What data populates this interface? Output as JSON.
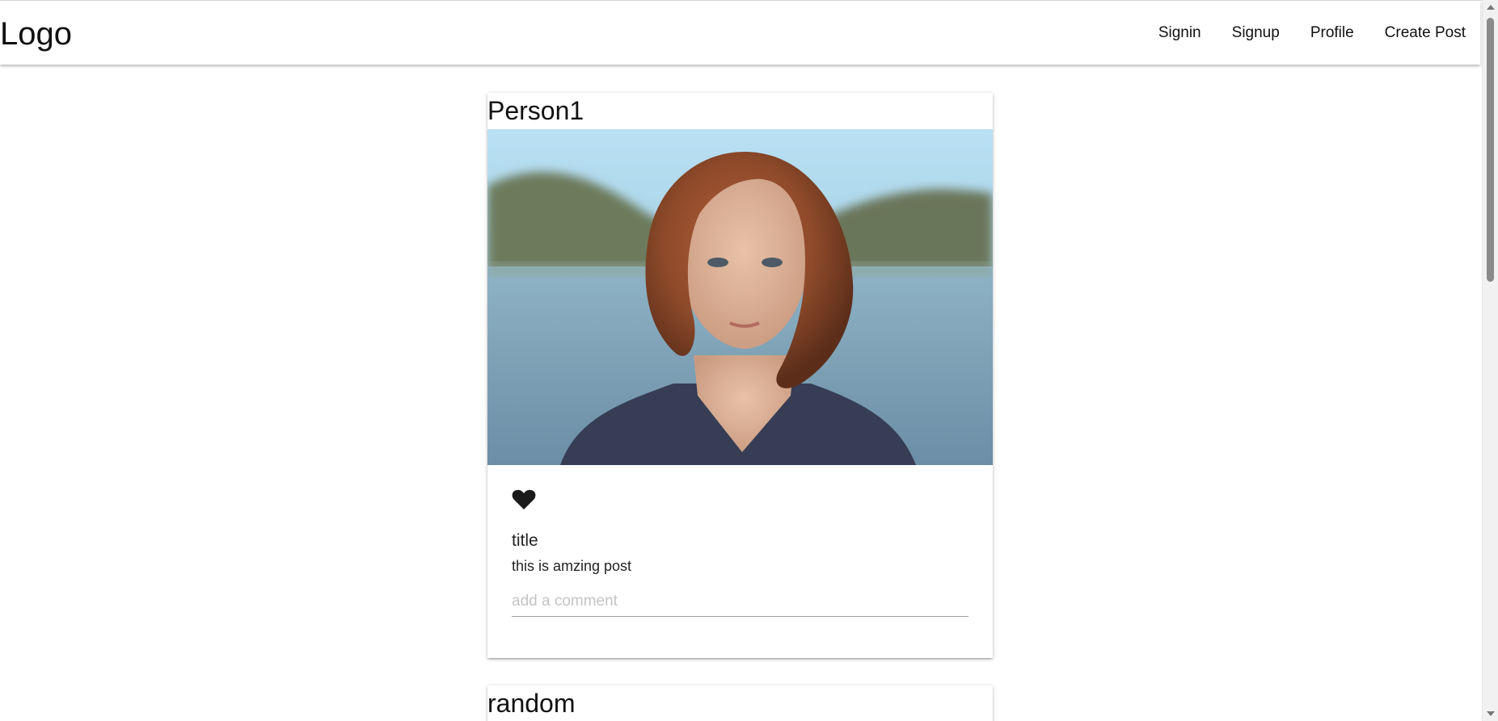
{
  "navbar": {
    "logo": "Logo",
    "links": [
      "Signin",
      "Signup",
      "Profile",
      "Create Post"
    ]
  },
  "posts": [
    {
      "author": "Person1",
      "title": "title",
      "body": "this is amzing post",
      "comment_placeholder": "add a comment",
      "liked": true
    },
    {
      "author": "random"
    }
  ],
  "colors": {
    "background": "#ffffff",
    "text": "#111111",
    "heart": "#1a1a1a",
    "placeholder": "#c4c4c4"
  },
  "icons": {
    "like": "heart-icon"
  }
}
